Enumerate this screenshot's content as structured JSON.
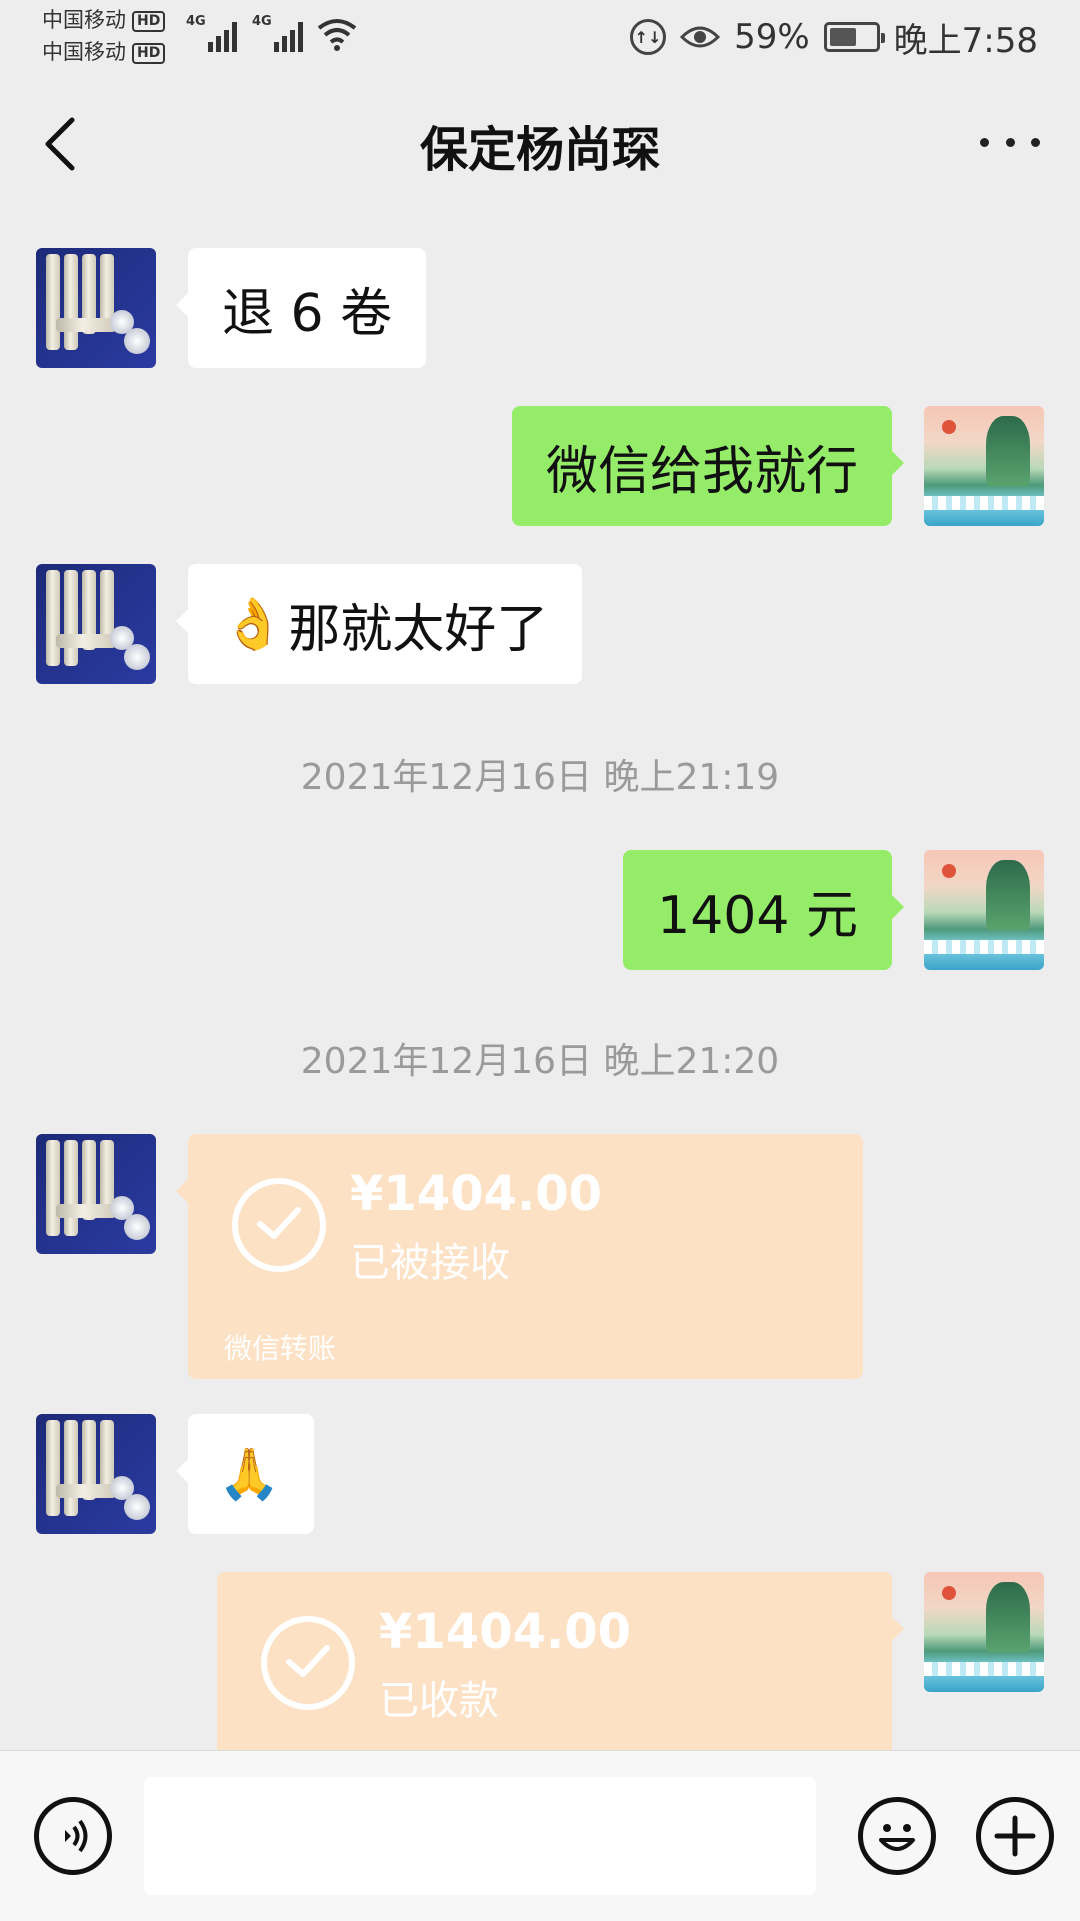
{
  "status_bar": {
    "carrier1": "中国移动",
    "carrier2": "中国移动",
    "hd_label": "HD",
    "network1": "4G",
    "network2": "4G",
    "battery_percent": "59%",
    "battery_level": 0.59,
    "time": "晚上7:58"
  },
  "header": {
    "title": "保定杨尚琛"
  },
  "messages": [
    {
      "side": "left",
      "text": "退 6 卷"
    },
    {
      "side": "right",
      "text": "微信给我就行"
    },
    {
      "side": "left",
      "emoji": "👌",
      "text": "那就太好了"
    },
    {
      "type": "timestamp",
      "text": "2021年12月16日 晚上21:19"
    },
    {
      "side": "right",
      "text": "1404 元"
    },
    {
      "type": "timestamp",
      "text": "2021年12月16日 晚上21:20"
    },
    {
      "side": "left",
      "type": "transfer",
      "amount": "¥1404.00",
      "status": "已被接收",
      "label": "微信转账"
    },
    {
      "side": "left",
      "emoji": "🙏"
    },
    {
      "side": "right",
      "type": "transfer",
      "amount": "¥1404.00",
      "status": "已收款"
    }
  ],
  "colors": {
    "background": "#ededed",
    "bubble_self": "#95ec69",
    "bubble_other": "#ffffff",
    "transfer": "#fde1c5",
    "timestamp": "#9a9a9a"
  }
}
